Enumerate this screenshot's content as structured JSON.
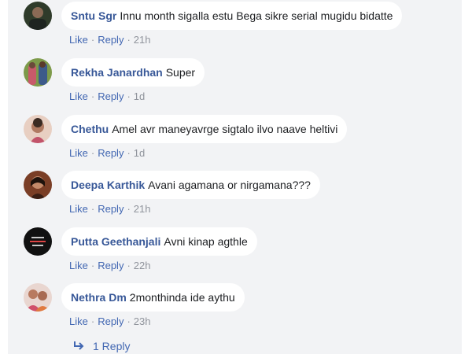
{
  "comments": [
    {
      "author": "Sntu Sgr",
      "text": "Innu month sigalla estu Bega sikre serial mugidu bidatte",
      "like": "Like",
      "reply": "Reply",
      "time": "21h",
      "avatar_color": "#3a4a33"
    },
    {
      "author": "Rekha Janardhan",
      "text": "Super",
      "like": "Like",
      "reply": "Reply",
      "time": "1d",
      "avatar_color": "#6a8a3a"
    },
    {
      "author": "Chethu",
      "text": "Amel avr maneyavrge sigtalo ilvo naave heltivi",
      "like": "Like",
      "reply": "Reply",
      "time": "1d",
      "avatar_color": "#d9b0a0"
    },
    {
      "author": "Deepa Karthik",
      "text": "Avani agamana or nirgamana???",
      "like": "Like",
      "reply": "Reply",
      "time": "21h",
      "avatar_color": "#6b3a24"
    },
    {
      "author": "Putta Geethanjali",
      "text": "Avni kinap agthle",
      "like": "Like",
      "reply": "Reply",
      "time": "22h",
      "avatar_color": "#151515"
    },
    {
      "author": "Nethra Dm",
      "text": "2monthinda ide aythu",
      "like": "Like",
      "reply": "Reply",
      "time": "23h",
      "avatar_color": "#c86070"
    }
  ],
  "replies_link": "1 Reply",
  "separator": "·",
  "icons": {
    "reply_arrow": "reply-arrow-icon"
  }
}
